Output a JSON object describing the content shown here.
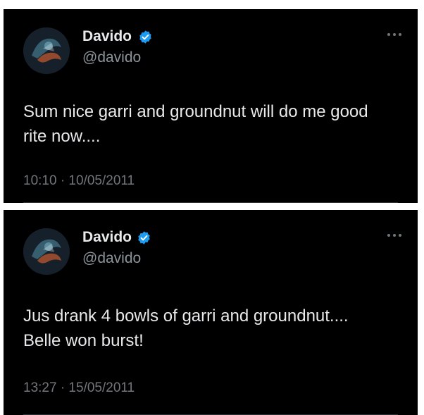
{
  "colors": {
    "card_background": "#000000",
    "primary_text": "#e7e9ea",
    "secondary_text": "#8b949a",
    "verified_blue": "#1d9bf0"
  },
  "tweets": [
    {
      "display_name": "Davido",
      "handle": "@davido",
      "text_lines": [
        "Sum nice garri and groundnut will do me good",
        "rite now...."
      ],
      "timestamp": "10:10 · 10/05/2011",
      "avatar_icon": "avatar-image",
      "more_icon": "more-options-icon",
      "badge_icon": "verified-badge-icon"
    },
    {
      "display_name": "Davido",
      "handle": "@davido",
      "text_lines": [
        "Jus drank 4 bowls of garri and groundnut....",
        "Belle won burst!"
      ],
      "timestamp": "13:27 · 15/05/2011",
      "avatar_icon": "avatar-image",
      "more_icon": "more-options-icon",
      "badge_icon": "verified-badge-icon"
    }
  ]
}
